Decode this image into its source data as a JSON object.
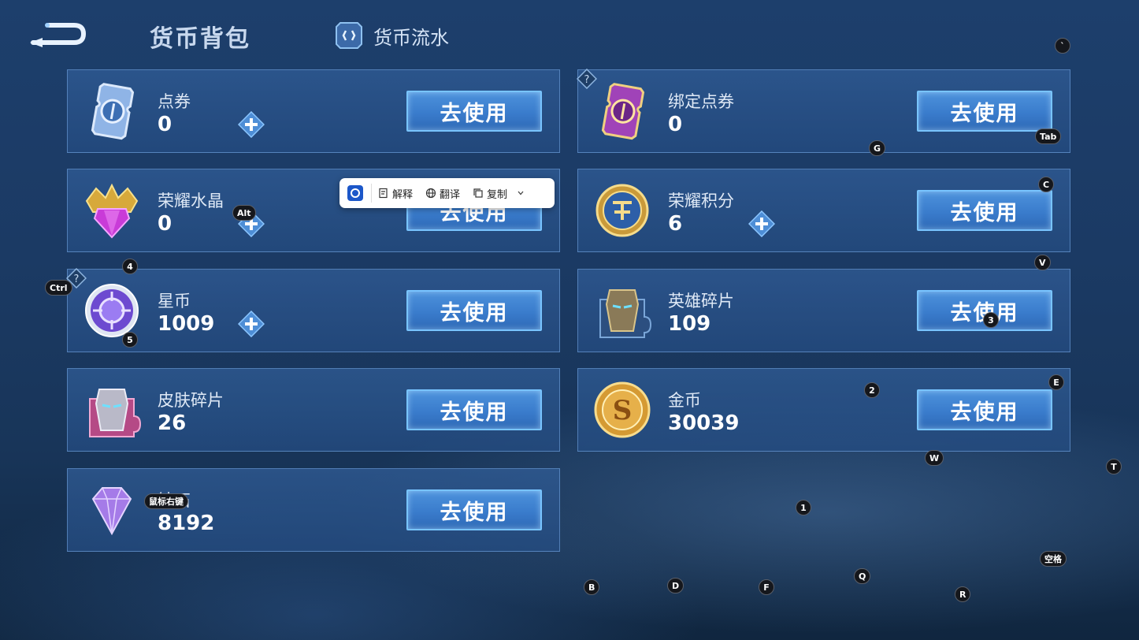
{
  "header": {
    "title": "货币背包",
    "flow_link": "货币流水"
  },
  "currencies": [
    {
      "name": "点券",
      "amount": "0",
      "button": "去使用",
      "has_plus": true
    },
    {
      "name": "绑定点券",
      "amount": "0",
      "button": "去使用",
      "has_plus": false,
      "has_help": true
    },
    {
      "name": "荣耀水晶",
      "amount": "0",
      "button": "去使用",
      "has_plus": true
    },
    {
      "name": "荣耀积分",
      "amount": "6",
      "button": "去使用",
      "has_plus": true
    },
    {
      "name": "星币",
      "amount": "1009",
      "button": "去使用",
      "has_plus": true,
      "has_help": true
    },
    {
      "name": "英雄碎片",
      "amount": "109",
      "button": "去使用",
      "has_plus": false
    },
    {
      "name": "皮肤碎片",
      "amount": "26",
      "button": "去使用",
      "has_plus": false
    },
    {
      "name": "金币",
      "amount": "30039",
      "button": "去使用",
      "has_plus": false
    },
    {
      "name": "钻石",
      "amount": "8192",
      "button": "去使用",
      "has_plus": false
    }
  ],
  "context_menu": {
    "explain": "解释",
    "translate": "翻译",
    "copy": "复制"
  },
  "key_hints": {
    "tab": "Tab",
    "g": "G",
    "c": "C",
    "alt": "Alt",
    "v": "V",
    "ctrl": "Ctrl",
    "k4": "4",
    "k5": "5",
    "k3": "3",
    "k2": "2",
    "e": "E",
    "w": "W",
    "t": "T",
    "k1": "1",
    "right_click": "鼠标右键",
    "space": "空格",
    "q": "Q",
    "b": "B",
    "d": "D",
    "f": "F",
    "r": "R",
    "backtick": "`"
  },
  "colors": {
    "button_fill": "#3a7ccc",
    "button_border": "#78c4ff",
    "card_border": "#78aae6",
    "background": "#1b3a64"
  }
}
